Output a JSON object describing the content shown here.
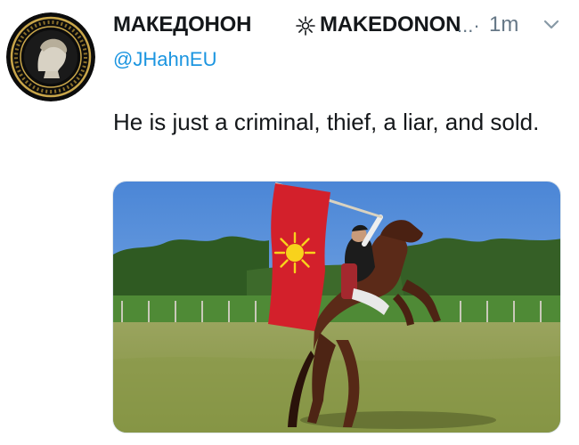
{
  "tweet": {
    "display_name": "МАКЕДОНОН",
    "display_name_latin": "MAKEDONON",
    "truncation": "...·",
    "timestamp": "1m",
    "handle": "@JHahnEU",
    "text": "He is just a criminal,  thief, a liar, and sold.",
    "icons": {
      "name_symbol": "vergina-sun-icon",
      "menu": "chevron-down-icon"
    },
    "colors": {
      "handle": "#1b95e0",
      "meta": "#657786",
      "flag_red": "#d3202b",
      "flag_sun": "#f8d21c"
    }
  }
}
